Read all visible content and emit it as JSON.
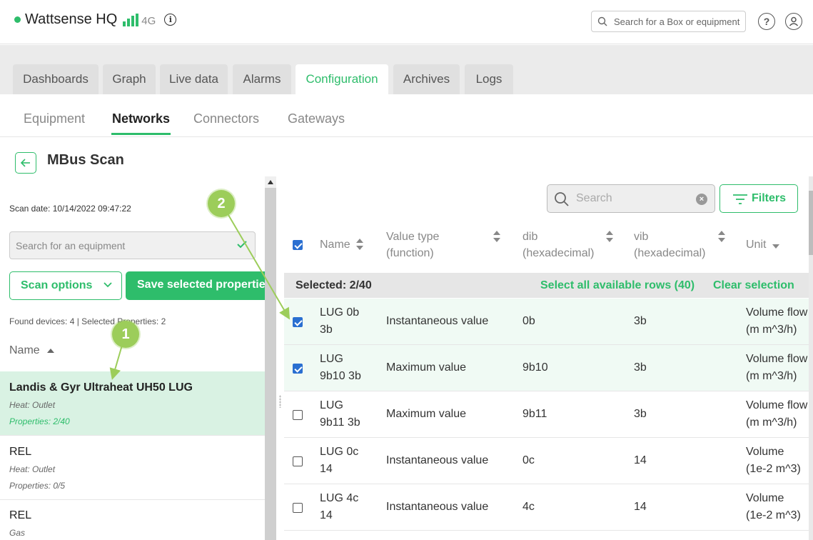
{
  "header": {
    "site_name": "Wattsense HQ",
    "network": "4G",
    "search_placeholder": "Search for a Box or equipment"
  },
  "main_tabs": [
    {
      "label": "Dashboards"
    },
    {
      "label": "Graph"
    },
    {
      "label": "Live data"
    },
    {
      "label": "Alarms"
    },
    {
      "label": "Configuration",
      "active": true
    },
    {
      "label": "Archives"
    },
    {
      "label": "Logs"
    }
  ],
  "sub_tabs": [
    {
      "label": "Equipment"
    },
    {
      "label": "Networks",
      "active": true
    },
    {
      "label": "Connectors"
    },
    {
      "label": "Gateways"
    }
  ],
  "page": {
    "title": "MBus Scan"
  },
  "left_panel": {
    "scan_date": "Scan date: 10/14/2022 09:47:22",
    "search_placeholder": "Search for an equipment",
    "scan_options_label": "Scan options",
    "save_label": "Save selected properties",
    "found_text": "Found devices: 4 | Selected Properties: 2",
    "name_header": "Name",
    "devices": [
      {
        "name": "Landis & Gyr Ultraheat UH50 LUG",
        "type": "Heat: Outlet",
        "properties": "Properties: 2/40",
        "selected": true
      },
      {
        "name": "REL",
        "type": "Heat: Outlet",
        "properties": "Properties: 0/5",
        "selected": false
      },
      {
        "name": "REL",
        "type": "Gas",
        "properties": "",
        "selected": false
      }
    ]
  },
  "right_panel": {
    "search_placeholder": "Search",
    "filters_label": "Filters",
    "columns": {
      "name": "Name",
      "value_type_1": "Value type",
      "value_type_2": "(function)",
      "dib_1": "dib",
      "dib_2": "(hexadecimal)",
      "vib_1": "vib",
      "vib_2": "(hexadecimal)",
      "unit": "Unit"
    },
    "selection": {
      "count": "Selected: 2/40",
      "select_all": "Select all available rows (40)",
      "clear": "Clear selection"
    },
    "rows": [
      {
        "name_1": "LUG 0b",
        "name_2": "3b",
        "value_type": "Instantaneous value",
        "dib": "0b",
        "vib": "3b",
        "unit_1": "Volume flow",
        "unit_2": "(m m^3/h)",
        "checked": true
      },
      {
        "name_1": "LUG",
        "name_2": "9b10 3b",
        "value_type": "Maximum value",
        "dib": "9b10",
        "vib": "3b",
        "unit_1": "Volume flow",
        "unit_2": "(m m^3/h)",
        "checked": true
      },
      {
        "name_1": "LUG",
        "name_2": "9b11 3b",
        "value_type": "Maximum value",
        "dib": "9b11",
        "vib": "3b",
        "unit_1": "Volume flow",
        "unit_2": "(m m^3/h)",
        "checked": false
      },
      {
        "name_1": "LUG 0c",
        "name_2": "14",
        "value_type": "Instantaneous value",
        "dib": "0c",
        "vib": "14",
        "unit_1": "Volume",
        "unit_2": "(1e-2 m^3)",
        "checked": false
      },
      {
        "name_1": "LUG 4c",
        "name_2": "14",
        "value_type": "Instantaneous value",
        "dib": "4c",
        "vib": "14",
        "unit_1": "Volume",
        "unit_2": "(1e-2 m^3)",
        "checked": false
      }
    ]
  },
  "annotations": [
    {
      "label": "1"
    },
    {
      "label": "2"
    }
  ],
  "colors": {
    "accent": "#2ebd6b",
    "checkbox": "#2a6fd1",
    "annotation": "#9ccd5a"
  }
}
